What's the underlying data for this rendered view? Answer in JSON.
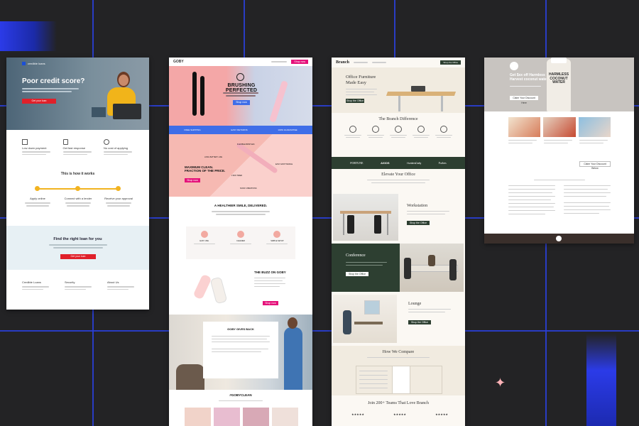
{
  "credit_page": {
    "nav_brand": "credible loans",
    "hero_title": "Poor credit score?",
    "hero_cta": "Get your loan",
    "features": [
      "Low down payment",
      "Get fast response",
      "No cost of applying"
    ],
    "how_title": "This is how it works",
    "steps": [
      "Apply online",
      "Connect with a lender",
      "Receive your approval"
    ],
    "find_title": "Find the right loan for you",
    "find_cta": "Get your loan",
    "footer_cols": [
      "Credible Loans",
      "Security",
      "About Us"
    ]
  },
  "goby_page": {
    "logo": "GOBY",
    "nav_btn": "Shop now",
    "hero_title": "BRUSHING PERFECTED",
    "hero_cta": "Shop now",
    "band_items": [
      "FREE SHIPPING",
      "EASY RETURNS",
      "100% GUARANTEE"
    ],
    "max_clean": "MAXIMUM CLEAN.\nFRACTION OF THE PRICE.",
    "callouts": [
      "FLEXIBLE BRISTLES",
      "LONG BATTERY LIFE",
      "EASY-GRIP HANDLE",
      "2 MIN TIMER",
      "SONIC VIBRATIONS"
    ],
    "healthier": "A HEALTHIER SMILE, DELIVERED.",
    "benefits": [
      "EASY USE",
      "CLEANER",
      "SIMPLE SETUP"
    ],
    "buzz": "THE BUZZ ON GOBY",
    "gives_back": "GOBY GIVES BACK",
    "social": "#GOBYCLEAN"
  },
  "branch_page": {
    "logo": "Branch",
    "nav_btn": "Shop the Office",
    "hero_title": "Office Furniture\nMade Easy",
    "hero_cta": "Shop the Office",
    "difference": "The Branch Difference",
    "press": [
      "FORTUNE",
      "AXIOS",
      "HuntersDaily",
      "Forbes"
    ],
    "elevate": "Elevate Your Office",
    "sections": [
      "Workstation",
      "Conference",
      "Lounge"
    ],
    "section_cta": "Shop the Office",
    "compare": "How We Compare",
    "teams": "Join 200+ Teams That Love Branch"
  },
  "coconut_page": {
    "hero_title": "Get $xx off Harmless\nHarvest coconut water",
    "hero_cta": "Claim Your Discount Here",
    "bottle_label": "HARMLESS\nCOCONUT\nWATER",
    "sub_cta": "Claim Your Discount Below"
  },
  "colors": {
    "background": "#232325",
    "grid": "#2a3fd6",
    "credit_red": "#e0202a",
    "goby_pink": "#f4a7a7",
    "goby_magenta": "#e5117a",
    "branch_green": "#2d3f31"
  }
}
